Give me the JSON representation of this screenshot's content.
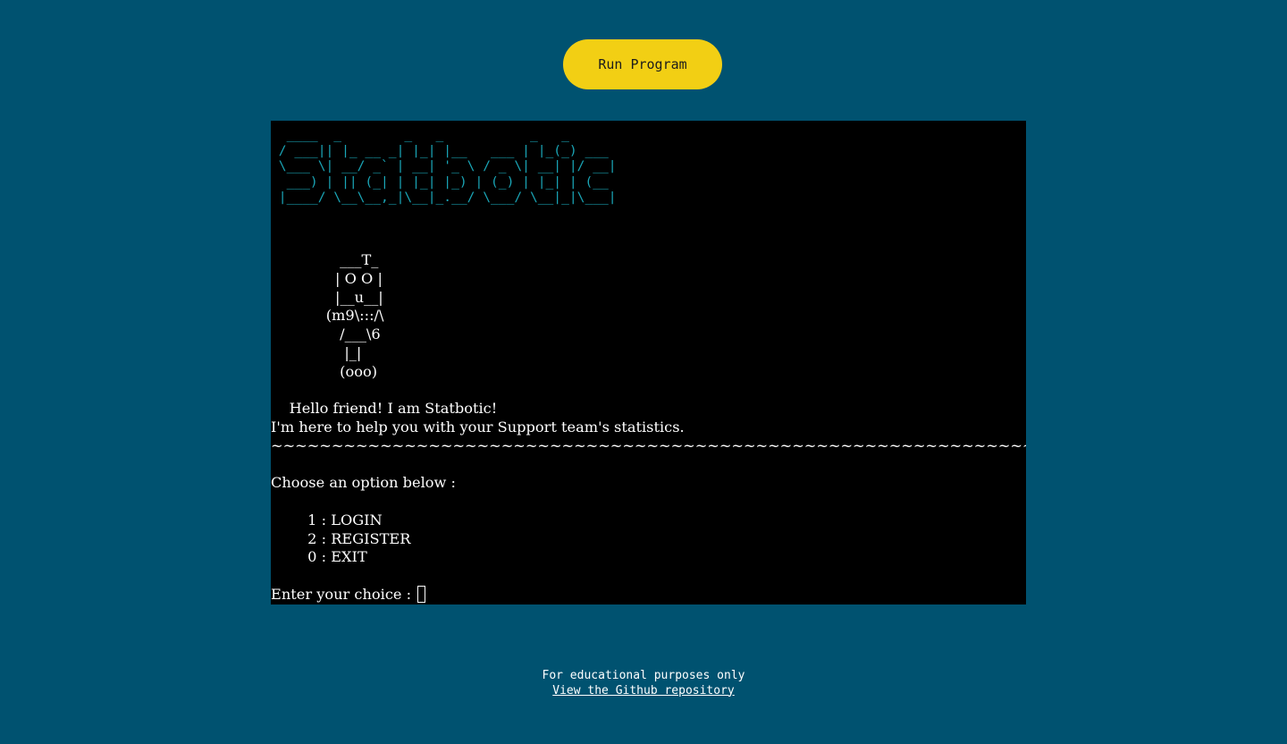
{
  "run_button": {
    "label": "Run Program"
  },
  "terminal": {
    "banner_lines": [
      "  ____  _        _   _           _   _      ",
      " / ___|| |_ __ _| |_| |__   ___ | |_(_) ___ ",
      " \\___ \\| __/ _` | __| '_ \\ / _ \\| __| |/ __|",
      "  ___) | || (_| | |_| |_) | (_) | |_| | (__ ",
      " |____/ \\__\\__,_|\\__|_.__/ \\___/ \\__|_|\\___|"
    ],
    "robot_lines": [
      "               ___T_",
      "              | O O |",
      "              |__u__|",
      "            (m9\\:::/\\",
      "               /___\\6",
      "                |_|",
      "               (ooo)"
    ],
    "greeting": "    Hello friend! I am Statbotic!",
    "intro": "I'm here to help you with your Support team's statistics.",
    "separator": "~~~~~~~~~~~~~~~~~~~~~~~~~~~~~~~~~~~~~~~~~~~~~~~~~~~~~~~~~~~~~~~~~~~~~~",
    "choose_prompt": "Choose an option below :",
    "options": [
      "        1 : LOGIN",
      "        2 : REGISTER",
      "        0 : EXIT"
    ],
    "input_prompt": "Enter your choice : "
  },
  "footer": {
    "note": "For educational purposes only",
    "repo_link": "View the Github repository"
  },
  "colors": {
    "background": "#005270",
    "button": "#f2cf14",
    "terminal_bg": "#000000",
    "banner": "#1aa6b7"
  }
}
